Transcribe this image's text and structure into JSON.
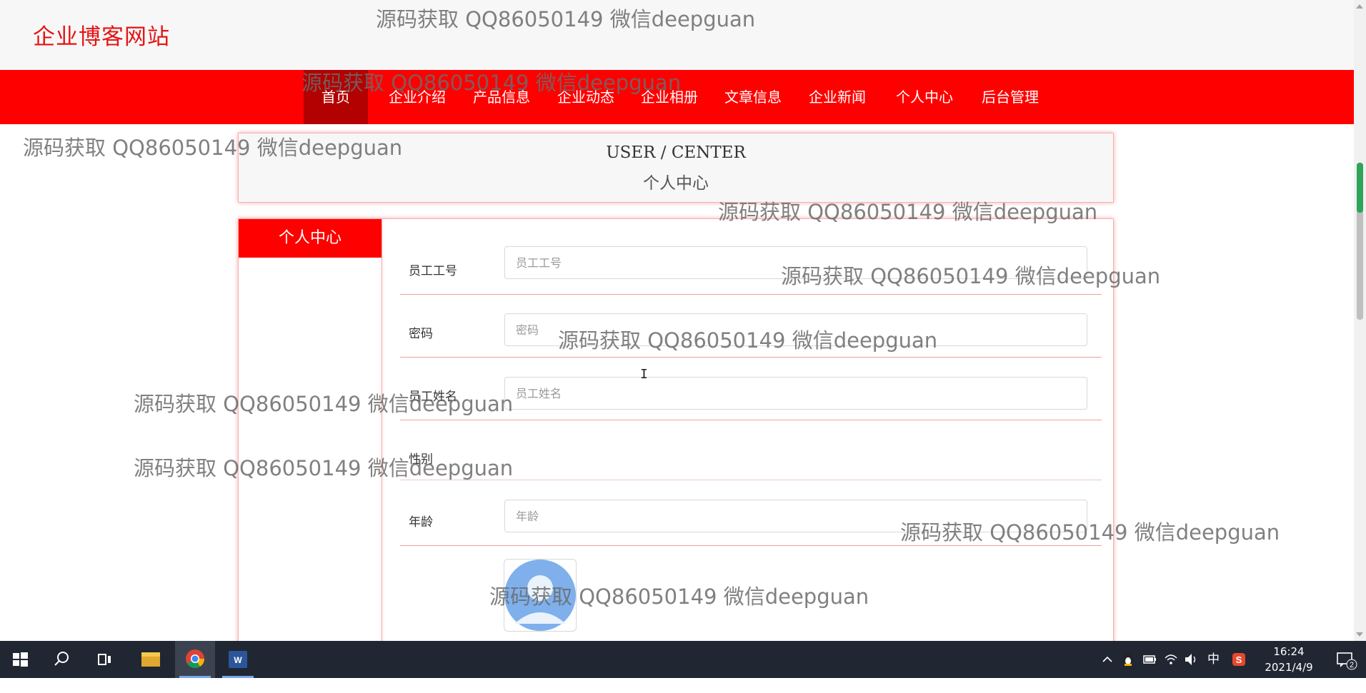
{
  "site": {
    "title": "企业博客网站"
  },
  "nav": {
    "items": [
      {
        "label": "首页"
      },
      {
        "label": "企业介绍"
      },
      {
        "label": "产品信息"
      },
      {
        "label": "企业动态"
      },
      {
        "label": "企业相册"
      },
      {
        "label": "文章信息"
      },
      {
        "label": "企业新闻"
      },
      {
        "label": "个人中心"
      },
      {
        "label": "后台管理"
      }
    ],
    "active_index": 0
  },
  "center": {
    "title_en": "USER / CENTER",
    "title_cn": "个人中心"
  },
  "sidebar": {
    "tab_label": "个人中心"
  },
  "form": {
    "fields": [
      {
        "label": "员工工号",
        "placeholder": "员工工号",
        "value": ""
      },
      {
        "label": "密码",
        "placeholder": "密码",
        "value": ""
      },
      {
        "label": "员工姓名",
        "placeholder": "员工姓名",
        "value": ""
      },
      {
        "label": "性别"
      },
      {
        "label": "年龄",
        "placeholder": "年龄",
        "value": ""
      }
    ]
  },
  "watermark": "源码获取 QQ86050149 微信deepguan",
  "taskbar": {
    "time": "16:24",
    "date": "2021/4/9",
    "ime": "中",
    "notification_count": "2"
  },
  "colors": {
    "brand_red": "#ff0000",
    "active_nav": "#b30000",
    "title_red": "#e51414"
  }
}
